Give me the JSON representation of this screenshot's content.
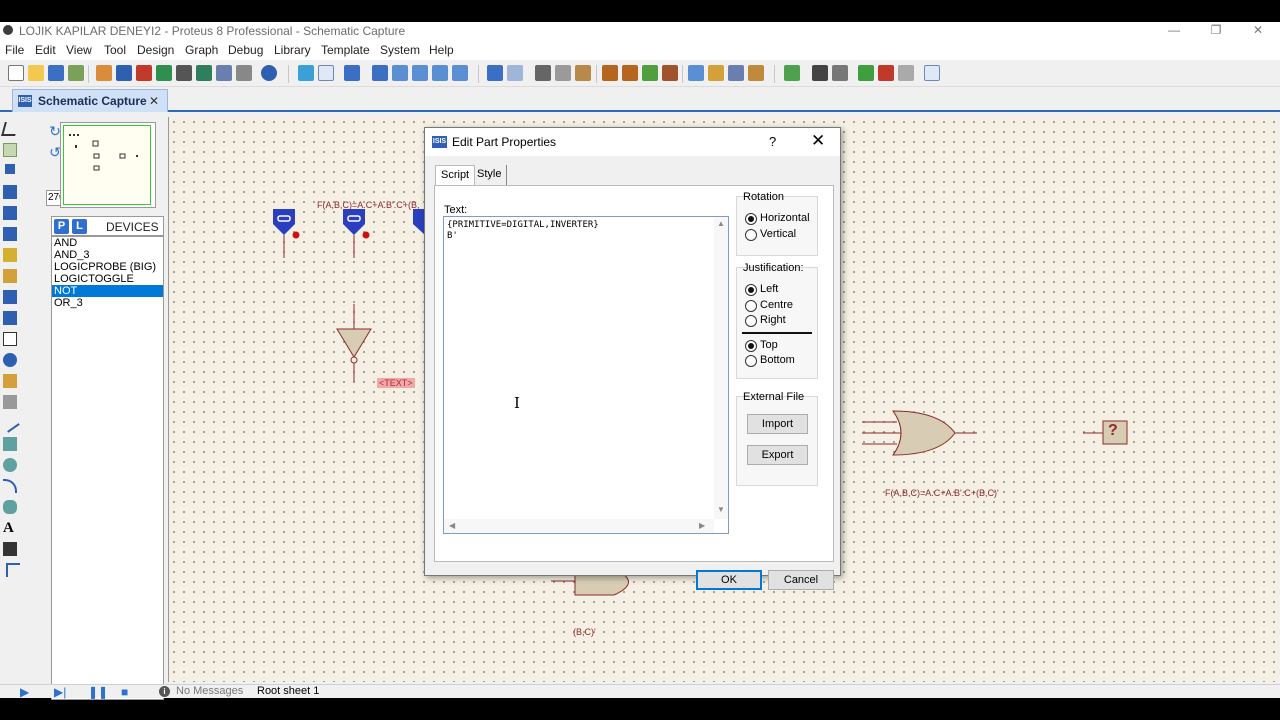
{
  "window": {
    "title": "LOJIK KAPILAR DENEYI2 - Proteus 8 Professional - Schematic Capture",
    "minimize": "—",
    "restore": "❐",
    "close": "✕"
  },
  "menu": [
    "File",
    "Edit",
    "View",
    "Tool",
    "Design",
    "Graph",
    "Debug",
    "Library",
    "Template",
    "System",
    "Help"
  ],
  "tab": {
    "label": "Schematic Capture",
    "close": "✕",
    "icon_text": "ISIS"
  },
  "angle": "270°",
  "devices": {
    "p_button": "P",
    "l_button": "L",
    "header": "DEVICES",
    "items": [
      "AND",
      "AND_3",
      "LOGICPROBE (BIG)",
      "LOGICTOGGLE",
      "NOT",
      "OR_3"
    ],
    "selected_index": 4
  },
  "canvas": {
    "top_label": "F(A,B,C)=A.C+A.B'.C+(B,",
    "text_tag": "<TEXT>",
    "or_label": "F(A,B,C)=A.C+A.B'.C+(B,C)'",
    "bottom_label": "(B,C)'",
    "probe_mark": "?"
  },
  "dialog": {
    "title": "Edit Part Properties",
    "help": "?",
    "close": "✕",
    "tabs": [
      "Script",
      "Style"
    ],
    "text_label": "Text:",
    "text_lines": [
      "{PRIMITIVE=DIGITAL,INVERTER}",
      "B'"
    ],
    "rotation": {
      "title": "Rotation",
      "options": [
        "Horizontal",
        "Vertical"
      ],
      "selected": "Horizontal"
    },
    "justification": {
      "title": "Justification:",
      "horizontal": [
        "Left",
        "Centre",
        "Right"
      ],
      "horizontal_selected": "Left",
      "vertical": [
        "Top",
        "Bottom"
      ],
      "vertical_selected": "Top"
    },
    "external_file": {
      "title": "External File",
      "import": "Import",
      "export": "Export"
    },
    "ok": "OK",
    "cancel": "Cancel"
  },
  "status": {
    "messages": "No Messages",
    "sheet": "Root sheet 1"
  },
  "colors": {
    "canvas_bg": "#f5f0e3",
    "component": "#8b2a2a",
    "gate_fill": "#d8cdb4",
    "probe_blue": "#2a3fbf",
    "selection": "#0078d7"
  }
}
